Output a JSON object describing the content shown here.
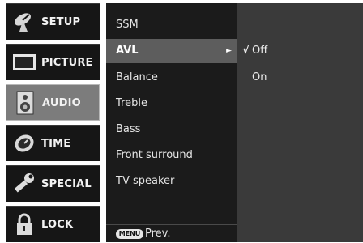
{
  "categories": [
    {
      "label": "SETUP",
      "icon": "satellite-dish-icon"
    },
    {
      "label": "PICTURE",
      "icon": "tv-screen-icon"
    },
    {
      "label": "AUDIO",
      "icon": "speaker-icon",
      "selected": true
    },
    {
      "label": "TIME",
      "icon": "clock-icon"
    },
    {
      "label": "SPECIAL",
      "icon": "wrench-icon"
    },
    {
      "label": "LOCK",
      "icon": "padlock-icon"
    }
  ],
  "menu": {
    "items": [
      {
        "label": "SSM"
      },
      {
        "label": "AVL",
        "selected": true
      },
      {
        "label": "Balance"
      },
      {
        "label": "Treble"
      },
      {
        "label": "Bass"
      },
      {
        "label": "Front surround"
      },
      {
        "label": "TV speaker"
      }
    ],
    "submenu_arrow": "►"
  },
  "options": [
    {
      "label": "Off",
      "checked": true,
      "check_mark": "√"
    },
    {
      "label": "On",
      "checked": false,
      "check_mark": ""
    }
  ],
  "footer": {
    "menu_key": "MENU",
    "prev_label": "Prev."
  },
  "colors": {
    "category_bg": "#161616",
    "category_selected_bg": "#7c7c7c",
    "menu_bg": "#1b1b1b",
    "menu_selected_bg": "#5d5d5d",
    "options_bg": "#3a3a3a"
  }
}
